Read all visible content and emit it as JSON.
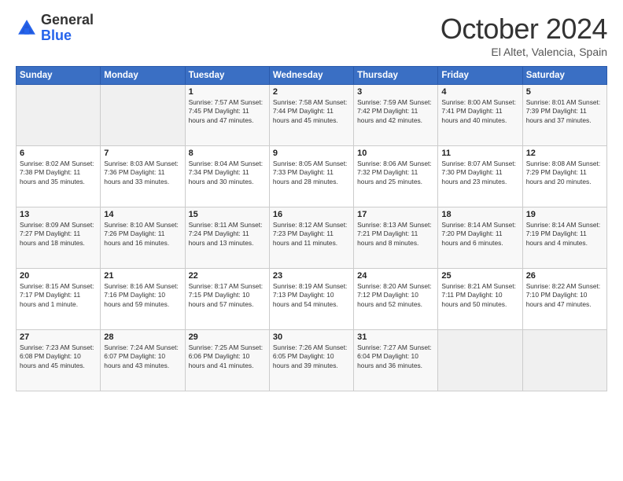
{
  "header": {
    "logo_general": "General",
    "logo_blue": "Blue",
    "month_title": "October 2024",
    "location": "El Altet, Valencia, Spain"
  },
  "weekdays": [
    "Sunday",
    "Monday",
    "Tuesday",
    "Wednesday",
    "Thursday",
    "Friday",
    "Saturday"
  ],
  "rows": [
    [
      {
        "day": "",
        "info": ""
      },
      {
        "day": "",
        "info": ""
      },
      {
        "day": "1",
        "info": "Sunrise: 7:57 AM\nSunset: 7:45 PM\nDaylight: 11 hours and 47 minutes."
      },
      {
        "day": "2",
        "info": "Sunrise: 7:58 AM\nSunset: 7:44 PM\nDaylight: 11 hours and 45 minutes."
      },
      {
        "day": "3",
        "info": "Sunrise: 7:59 AM\nSunset: 7:42 PM\nDaylight: 11 hours and 42 minutes."
      },
      {
        "day": "4",
        "info": "Sunrise: 8:00 AM\nSunset: 7:41 PM\nDaylight: 11 hours and 40 minutes."
      },
      {
        "day": "5",
        "info": "Sunrise: 8:01 AM\nSunset: 7:39 PM\nDaylight: 11 hours and 37 minutes."
      }
    ],
    [
      {
        "day": "6",
        "info": "Sunrise: 8:02 AM\nSunset: 7:38 PM\nDaylight: 11 hours and 35 minutes."
      },
      {
        "day": "7",
        "info": "Sunrise: 8:03 AM\nSunset: 7:36 PM\nDaylight: 11 hours and 33 minutes."
      },
      {
        "day": "8",
        "info": "Sunrise: 8:04 AM\nSunset: 7:34 PM\nDaylight: 11 hours and 30 minutes."
      },
      {
        "day": "9",
        "info": "Sunrise: 8:05 AM\nSunset: 7:33 PM\nDaylight: 11 hours and 28 minutes."
      },
      {
        "day": "10",
        "info": "Sunrise: 8:06 AM\nSunset: 7:32 PM\nDaylight: 11 hours and 25 minutes."
      },
      {
        "day": "11",
        "info": "Sunrise: 8:07 AM\nSunset: 7:30 PM\nDaylight: 11 hours and 23 minutes."
      },
      {
        "day": "12",
        "info": "Sunrise: 8:08 AM\nSunset: 7:29 PM\nDaylight: 11 hours and 20 minutes."
      }
    ],
    [
      {
        "day": "13",
        "info": "Sunrise: 8:09 AM\nSunset: 7:27 PM\nDaylight: 11 hours and 18 minutes."
      },
      {
        "day": "14",
        "info": "Sunrise: 8:10 AM\nSunset: 7:26 PM\nDaylight: 11 hours and 16 minutes."
      },
      {
        "day": "15",
        "info": "Sunrise: 8:11 AM\nSunset: 7:24 PM\nDaylight: 11 hours and 13 minutes."
      },
      {
        "day": "16",
        "info": "Sunrise: 8:12 AM\nSunset: 7:23 PM\nDaylight: 11 hours and 11 minutes."
      },
      {
        "day": "17",
        "info": "Sunrise: 8:13 AM\nSunset: 7:21 PM\nDaylight: 11 hours and 8 minutes."
      },
      {
        "day": "18",
        "info": "Sunrise: 8:14 AM\nSunset: 7:20 PM\nDaylight: 11 hours and 6 minutes."
      },
      {
        "day": "19",
        "info": "Sunrise: 8:14 AM\nSunset: 7:19 PM\nDaylight: 11 hours and 4 minutes."
      }
    ],
    [
      {
        "day": "20",
        "info": "Sunrise: 8:15 AM\nSunset: 7:17 PM\nDaylight: 11 hours and 1 minute."
      },
      {
        "day": "21",
        "info": "Sunrise: 8:16 AM\nSunset: 7:16 PM\nDaylight: 10 hours and 59 minutes."
      },
      {
        "day": "22",
        "info": "Sunrise: 8:17 AM\nSunset: 7:15 PM\nDaylight: 10 hours and 57 minutes."
      },
      {
        "day": "23",
        "info": "Sunrise: 8:19 AM\nSunset: 7:13 PM\nDaylight: 10 hours and 54 minutes."
      },
      {
        "day": "24",
        "info": "Sunrise: 8:20 AM\nSunset: 7:12 PM\nDaylight: 10 hours and 52 minutes."
      },
      {
        "day": "25",
        "info": "Sunrise: 8:21 AM\nSunset: 7:11 PM\nDaylight: 10 hours and 50 minutes."
      },
      {
        "day": "26",
        "info": "Sunrise: 8:22 AM\nSunset: 7:10 PM\nDaylight: 10 hours and 47 minutes."
      }
    ],
    [
      {
        "day": "27",
        "info": "Sunrise: 7:23 AM\nSunset: 6:08 PM\nDaylight: 10 hours and 45 minutes."
      },
      {
        "day": "28",
        "info": "Sunrise: 7:24 AM\nSunset: 6:07 PM\nDaylight: 10 hours and 43 minutes."
      },
      {
        "day": "29",
        "info": "Sunrise: 7:25 AM\nSunset: 6:06 PM\nDaylight: 10 hours and 41 minutes."
      },
      {
        "day": "30",
        "info": "Sunrise: 7:26 AM\nSunset: 6:05 PM\nDaylight: 10 hours and 39 minutes."
      },
      {
        "day": "31",
        "info": "Sunrise: 7:27 AM\nSunset: 6:04 PM\nDaylight: 10 hours and 36 minutes."
      },
      {
        "day": "",
        "info": ""
      },
      {
        "day": "",
        "info": ""
      }
    ]
  ]
}
